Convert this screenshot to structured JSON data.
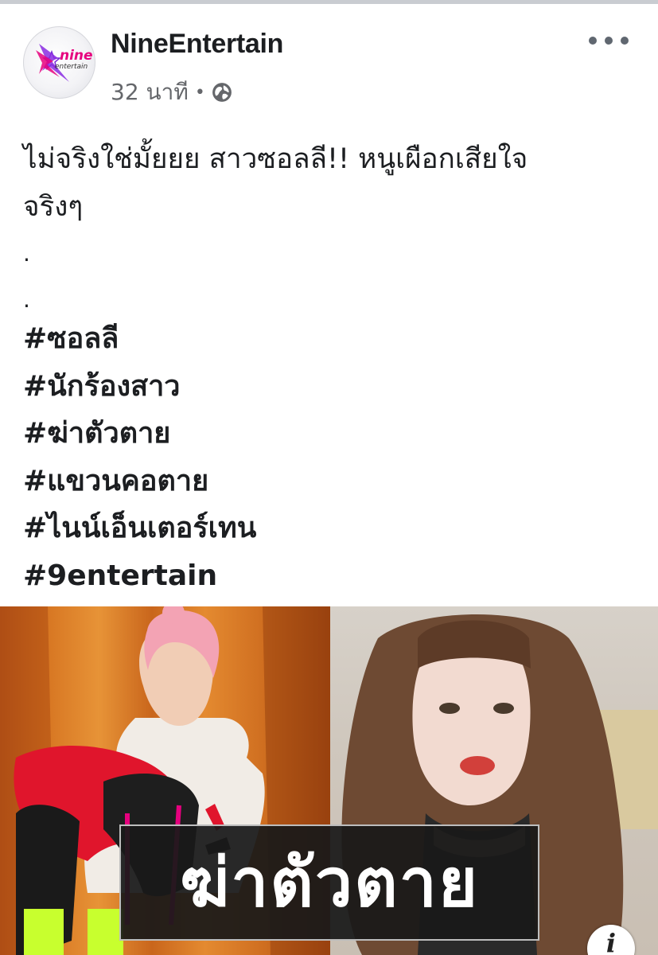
{
  "post": {
    "page_name": "NineEntertain",
    "avatar_logo_text": "nine entertain",
    "time": "32 นาที",
    "separator": "•",
    "privacy_icon": "globe-icon",
    "more_icon": "more-options-icon",
    "text_lines": [
      "ไม่จริงใช่มั้ยยย สาวซอลลี!! หนูเผือกเสียใจ",
      "จริงๆ",
      ".",
      "."
    ],
    "hashtags": [
      "#ซอลลี",
      "#นักร้องสาว",
      "#ฆ่าตัวตาย",
      "#แขวนคอตาย",
      "#ไนน์เอ็นเตอร์เทน",
      "#9entertain"
    ]
  },
  "image": {
    "caption": "ฆ่าตัวตาย",
    "info_icon": "info-icon",
    "info_glyph": "i"
  },
  "colors": {
    "text": "#1c1e21",
    "meta": "#65676b",
    "logo_pink": "#e6007e",
    "logo_purple": "#7a2bd8",
    "caption_bg": "#191919"
  }
}
